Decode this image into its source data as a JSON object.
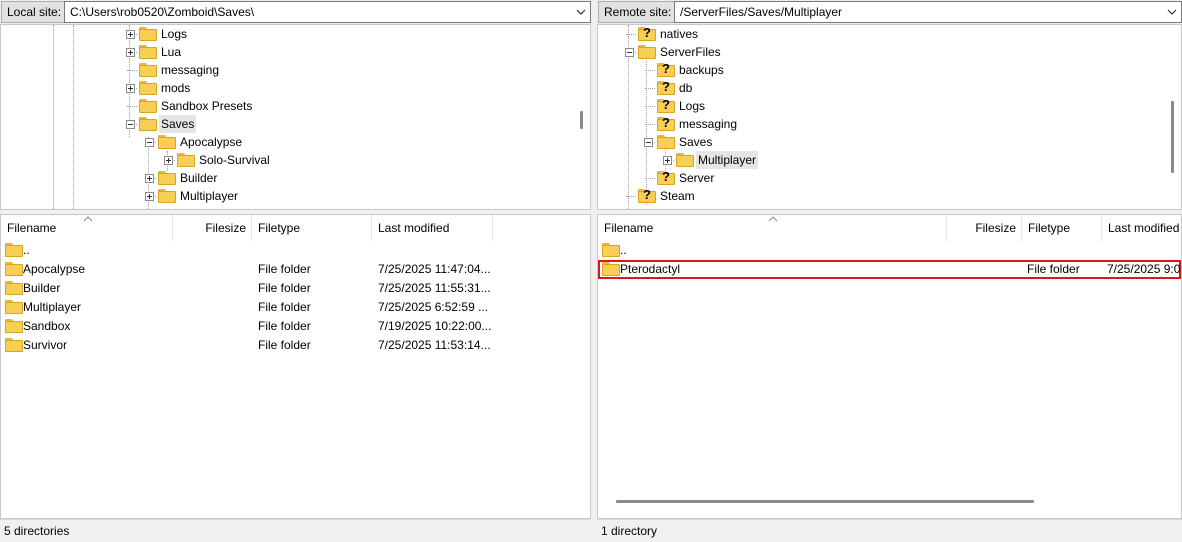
{
  "local": {
    "site_label": "Local site:",
    "path": "C:\\Users\\rob0520\\Zomboid\\Saves\\",
    "tree": [
      {
        "label": "Logs",
        "level": 0,
        "expander": "plus",
        "selected": false
      },
      {
        "label": "Lua",
        "level": 0,
        "expander": "plus",
        "selected": false
      },
      {
        "label": "messaging",
        "level": 0,
        "expander": "none",
        "selected": false
      },
      {
        "label": "mods",
        "level": 0,
        "expander": "plus",
        "selected": false
      },
      {
        "label": "Sandbox Presets",
        "level": 0,
        "expander": "none",
        "selected": false
      },
      {
        "label": "Saves",
        "level": 0,
        "expander": "minus",
        "selected": true
      },
      {
        "label": "Apocalypse",
        "level": 1,
        "expander": "minus",
        "selected": false
      },
      {
        "label": "Solo-Survival",
        "level": 2,
        "expander": "plus",
        "selected": false
      },
      {
        "label": "Builder",
        "level": 1,
        "expander": "plus",
        "selected": false
      },
      {
        "label": "Multiplayer",
        "level": 1,
        "expander": "plus",
        "selected": false
      }
    ],
    "columns": {
      "filename": "Filename",
      "filesize": "Filesize",
      "filetype": "Filetype",
      "modified": "Last modified"
    },
    "rows": [
      {
        "name": "..",
        "type": "",
        "modified": ""
      },
      {
        "name": "Apocalypse",
        "type": "File folder",
        "modified": "7/25/2025 11:47:04..."
      },
      {
        "name": "Builder",
        "type": "File folder",
        "modified": "7/25/2025 11:55:31..."
      },
      {
        "name": "Multiplayer",
        "type": "File folder",
        "modified": "7/25/2025 6:52:59 ..."
      },
      {
        "name": "Sandbox",
        "type": "File folder",
        "modified": "7/19/2025 10:22:00..."
      },
      {
        "name": "Survivor",
        "type": "File folder",
        "modified": "7/25/2025 11:53:14..."
      }
    ],
    "status": "5 directories"
  },
  "remote": {
    "site_label": "Remote site:",
    "path": "/ServerFiles/Saves/Multiplayer",
    "tree": [
      {
        "label": "natives",
        "level": 0,
        "expander": "none",
        "unknown": true,
        "selected": false
      },
      {
        "label": "ServerFiles",
        "level": 0,
        "expander": "minus",
        "unknown": false,
        "selected": false
      },
      {
        "label": "backups",
        "level": 1,
        "expander": "none",
        "unknown": true,
        "selected": false
      },
      {
        "label": "db",
        "level": 1,
        "expander": "none",
        "unknown": true,
        "selected": false
      },
      {
        "label": "Logs",
        "level": 1,
        "expander": "none",
        "unknown": true,
        "selected": false
      },
      {
        "label": "messaging",
        "level": 1,
        "expander": "none",
        "unknown": true,
        "selected": false
      },
      {
        "label": "Saves",
        "level": 1,
        "expander": "minus",
        "unknown": false,
        "selected": false
      },
      {
        "label": "Multiplayer",
        "level": 2,
        "expander": "plus",
        "unknown": false,
        "selected": true
      },
      {
        "label": "Server",
        "level": 1,
        "expander": "none",
        "unknown": true,
        "selected": false
      },
      {
        "label": "Steam",
        "level": 0,
        "expander": "none",
        "unknown": true,
        "selected": false
      }
    ],
    "columns": {
      "filename": "Filename",
      "filesize": "Filesize",
      "filetype": "Filetype",
      "modified": "Last modified"
    },
    "rows": [
      {
        "name": "..",
        "type": "",
        "modified": ""
      },
      {
        "name": "Pterodactyl",
        "type": "File folder",
        "modified": "7/25/2025 9:0"
      }
    ],
    "status": "1 directory"
  },
  "colors": {
    "folder": "#f8cf55",
    "highlight_border": "#e0141e",
    "selection": "#e5e5e5"
  }
}
